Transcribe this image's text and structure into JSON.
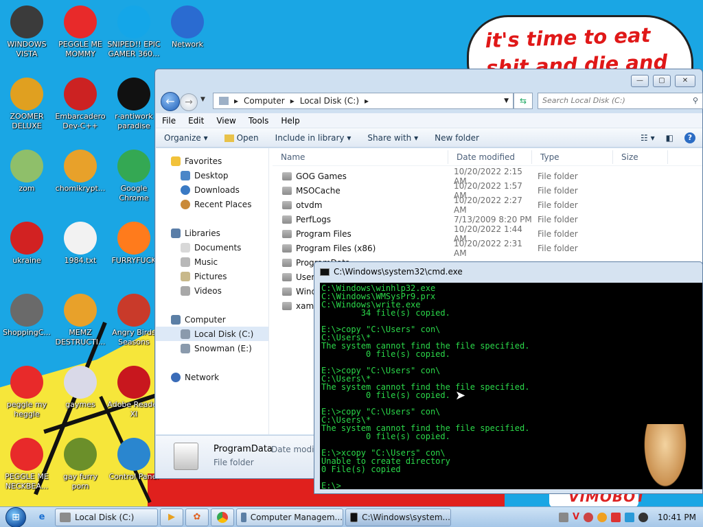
{
  "wallpaper": {
    "speech_text": "it's time to eat shit and die and chew",
    "mascot_text": "VIMOBOT"
  },
  "desktop_icons": [
    {
      "label": "WINDOWS VISTA",
      "icon": "windows-vista-icon",
      "color": "#3b3b3b"
    },
    {
      "label": "PEGGLE ME MOMMY",
      "icon": "peggle-icon",
      "color": "#e82a2a"
    },
    {
      "label": "SNIPED!! EPIC GAMER 360...",
      "icon": "skype-icon",
      "color": "#14a6e8"
    },
    {
      "label": "Network",
      "icon": "network-icon",
      "color": "#2a6bd1"
    },
    {
      "label": "ZOOMER DELUXE",
      "icon": "zoomer-icon",
      "color": "#e0a020"
    },
    {
      "label": "Embarcadero Dev-C++",
      "icon": "devcpp-icon",
      "color": "#cc2222"
    },
    {
      "label": "r-antiwork paradise",
      "icon": "antiwork-icon",
      "color": "#111111"
    },
    {
      "label": "zom",
      "icon": "zom-icon",
      "color": "#8fbf6a"
    },
    {
      "label": "chomikrypt...",
      "icon": "chomikrypt-icon",
      "color": "#e8a12a"
    },
    {
      "label": "Google Chrome",
      "icon": "chrome-icon",
      "color": "#34a853"
    },
    {
      "label": "ukraine",
      "icon": "radiation-icon",
      "color": "#d22222"
    },
    {
      "label": "1984.txt",
      "icon": "text-file-icon",
      "color": "#f2f2f2"
    },
    {
      "label": "FURRYFUCK",
      "icon": "firefox-icon",
      "color": "#ff7b1c"
    },
    {
      "label": "ShoppingC...",
      "icon": "flash-icon",
      "color": "#6a6a6a"
    },
    {
      "label": "MEMZ DESTRUCTI...",
      "icon": "memz-icon",
      "color": "#e8a12a"
    },
    {
      "label": "Angry Birds Seasons",
      "icon": "angry-birds-icon",
      "color": "#c93a2a"
    },
    {
      "label": "peggle my heggle",
      "icon": "peggle-icon",
      "color": "#e82a2a"
    },
    {
      "label": "gaymes",
      "icon": "media-file-icon",
      "color": "#d9d9e8"
    },
    {
      "label": "Adobe Reader XI",
      "icon": "adobe-reader-icon",
      "color": "#c8171e"
    },
    {
      "label": "PEGGLE ME NECKBEA...",
      "icon": "peggle-icon",
      "color": "#e82a2a"
    },
    {
      "label": "gay furry porn",
      "icon": "box-icon",
      "color": "#6b8f2a"
    },
    {
      "label": "Control Panel",
      "icon": "control-panel-icon",
      "color": "#2a86cf"
    }
  ],
  "explorer": {
    "breadcrumb": [
      "Computer",
      "Local Disk (C:)"
    ],
    "search_placeholder": "Search Local Disk (C:)",
    "menu": [
      "File",
      "Edit",
      "View",
      "Tools",
      "Help"
    ],
    "commands": [
      "Organize ▾",
      "Open",
      "Include in library ▾",
      "Share with ▾",
      "New folder"
    ],
    "nav": {
      "favorites_title": "Favorites",
      "favorites": [
        "Desktop",
        "Downloads",
        "Recent Places"
      ],
      "libraries_title": "Libraries",
      "libraries": [
        "Documents",
        "Music",
        "Pictures",
        "Videos"
      ],
      "computer_title": "Computer",
      "drives": [
        "Local Disk (C:)",
        "Snowman (E:)"
      ],
      "network_title": "Network"
    },
    "columns": [
      "Name",
      "Date modified",
      "Type",
      "Size"
    ],
    "files": [
      {
        "name": "GOG Games",
        "date": "10/20/2022 2:15 AM",
        "type": "File folder"
      },
      {
        "name": "MSOCache",
        "date": "10/20/2022 1:57 AM",
        "type": "File folder"
      },
      {
        "name": "otvdm",
        "date": "10/20/2022 2:27 AM",
        "type": "File folder"
      },
      {
        "name": "PerfLogs",
        "date": "7/13/2009 8:20 PM",
        "type": "File folder"
      },
      {
        "name": "Program Files",
        "date": "10/20/2022 1:44 AM",
        "type": "File folder"
      },
      {
        "name": "Program Files (x86)",
        "date": "10/20/2022 2:31 AM",
        "type": "File folder"
      },
      {
        "name": "ProgramData",
        "date": "",
        "type": ""
      },
      {
        "name": "Users",
        "date": "",
        "type": ""
      },
      {
        "name": "Windows",
        "date": "",
        "type": ""
      },
      {
        "name": "xampp",
        "date": "",
        "type": ""
      }
    ],
    "details": {
      "name": "ProgramData",
      "meta": "Date modifi",
      "type": "File folder"
    }
  },
  "cmd": {
    "title": "C:\\Windows\\system32\\cmd.exe",
    "lines": [
      "C:\\Windows\\winhlp32.exe",
      "C:\\Windows\\WMSysPr9.prx",
      "C:\\Windows\\write.exe",
      "        34 file(s) copied.",
      "",
      "E:\\>copy \"C:\\Users\" con\\",
      "C:\\Users\\*",
      "The system cannot find the file specified.",
      "         0 file(s) copied.",
      "",
      "E:\\>copy \"C:\\Users\" con\\",
      "C:\\Users\\*",
      "The system cannot find the file specified.",
      "         0 file(s) copied.",
      "",
      "E:\\>copy \"C:\\Users\" con\\",
      "C:\\Users\\*",
      "The system cannot find the file specified.",
      "         0 file(s) copied.",
      "",
      "E:\\>xcopy \"C:\\Users\" con\\",
      "Unable to create directory",
      "0 File(s) copied",
      "",
      "E:\\>"
    ]
  },
  "taskbar": {
    "buttons": [
      "Local Disk (C:)",
      "Computer Managem...",
      "C:\\Windows\\system..."
    ],
    "clock": "10:41 PM"
  }
}
